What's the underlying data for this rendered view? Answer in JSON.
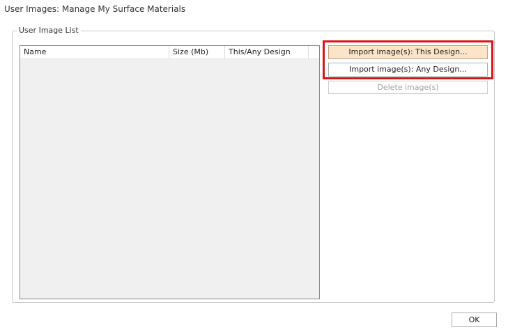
{
  "window": {
    "title": "User Images: Manage My Surface Materials"
  },
  "group": {
    "label": "User Image List"
  },
  "list": {
    "columns": [
      "Name",
      "Size (Mb)",
      "This/Any Design",
      ""
    ],
    "rows": []
  },
  "buttons": {
    "import_this": "Import image(s): This Design...",
    "import_any": "Import image(s): Any Design...",
    "delete": "Delete image(s)",
    "ok": "OK"
  },
  "colors": {
    "highlight": "#d9141a",
    "primary_button_bg": "#fce4c8"
  }
}
